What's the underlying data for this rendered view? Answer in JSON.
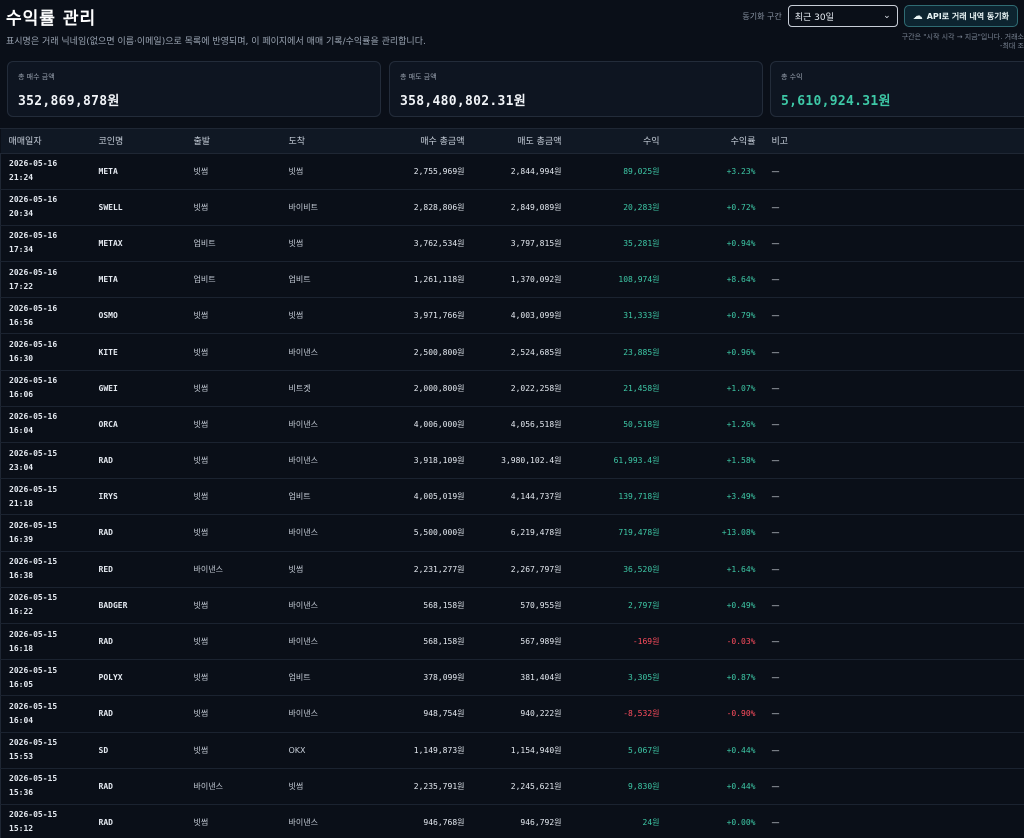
{
  "header": {
    "title": "수익률 관리",
    "description": "표시명은 거래 닉네임(없으면 이름·이메일)으로 목록에 반영되며, 이 페이지에서 매매 기록/수익률을 관리합니다."
  },
  "controls": {
    "sync_label": "동기화 구간",
    "range_value": "최근 30일",
    "sync_button": "API로 거래 내역 동기화"
  },
  "hint": {
    "line1": "구간은 \"시작 시각 → 지금\"입니다. 거래소",
    "line2": "-최대 조"
  },
  "cards": {
    "buy": {
      "label": "총 매수 금액",
      "value": "352,869,878원"
    },
    "sell": {
      "label": "총 매도 금액",
      "value": "358,480,802.31원"
    },
    "profit": {
      "label": "총 수익",
      "value": "5,610,924.31원"
    }
  },
  "table": {
    "headers": [
      "매매일자",
      "코인명",
      "출발",
      "도착",
      "매수 총금액",
      "매도 총금액",
      "수익",
      "수익률",
      "비고"
    ],
    "rows": [
      {
        "date": "2026-05-16",
        "time": "21:24",
        "coin": "META",
        "from": "빗썸",
        "to": "빗썸",
        "buy": "2,755,969원",
        "sell": "2,844,994원",
        "profit": "89,025원",
        "rate": "+3.23%",
        "note": "—",
        "sign": "pos"
      },
      {
        "date": "2026-05-16",
        "time": "20:34",
        "coin": "SWELL",
        "from": "빗썸",
        "to": "바이비트",
        "buy": "2,828,806원",
        "sell": "2,849,089원",
        "profit": "20,283원",
        "rate": "+0.72%",
        "note": "—",
        "sign": "pos"
      },
      {
        "date": "2026-05-16",
        "time": "17:34",
        "coin": "METAX",
        "from": "업비트",
        "to": "빗썸",
        "buy": "3,762,534원",
        "sell": "3,797,815원",
        "profit": "35,281원",
        "rate": "+0.94%",
        "note": "—",
        "sign": "pos"
      },
      {
        "date": "2026-05-16",
        "time": "17:22",
        "coin": "META",
        "from": "업비트",
        "to": "업비트",
        "buy": "1,261,118원",
        "sell": "1,370,092원",
        "profit": "108,974원",
        "rate": "+8.64%",
        "note": "—",
        "sign": "pos"
      },
      {
        "date": "2026-05-16",
        "time": "16:56",
        "coin": "OSMO",
        "from": "빗썸",
        "to": "빗썸",
        "buy": "3,971,766원",
        "sell": "4,003,099원",
        "profit": "31,333원",
        "rate": "+0.79%",
        "note": "—",
        "sign": "pos"
      },
      {
        "date": "2026-05-16",
        "time": "16:30",
        "coin": "KITE",
        "from": "빗썸",
        "to": "바이낸스",
        "buy": "2,500,800원",
        "sell": "2,524,685원",
        "profit": "23,885원",
        "rate": "+0.96%",
        "note": "—",
        "sign": "pos"
      },
      {
        "date": "2026-05-16",
        "time": "16:06",
        "coin": "GWEI",
        "from": "빗썸",
        "to": "비트겟",
        "buy": "2,000,800원",
        "sell": "2,022,258원",
        "profit": "21,458원",
        "rate": "+1.07%",
        "note": "—",
        "sign": "pos"
      },
      {
        "date": "2026-05-16",
        "time": "16:04",
        "coin": "ORCA",
        "from": "빗썸",
        "to": "바이낸스",
        "buy": "4,006,000원",
        "sell": "4,056,518원",
        "profit": "50,518원",
        "rate": "+1.26%",
        "note": "—",
        "sign": "pos"
      },
      {
        "date": "2026-05-15",
        "time": "23:04",
        "coin": "RAD",
        "from": "빗썸",
        "to": "바이낸스",
        "buy": "3,918,109원",
        "sell": "3,980,102.4원",
        "profit": "61,993.4원",
        "rate": "+1.58%",
        "note": "—",
        "sign": "pos"
      },
      {
        "date": "2026-05-15",
        "time": "21:18",
        "coin": "IRYS",
        "from": "빗썸",
        "to": "업비트",
        "buy": "4,005,019원",
        "sell": "4,144,737원",
        "profit": "139,718원",
        "rate": "+3.49%",
        "note": "—",
        "sign": "pos"
      },
      {
        "date": "2026-05-15",
        "time": "16:39",
        "coin": "RAD",
        "from": "빗썸",
        "to": "바이낸스",
        "buy": "5,500,000원",
        "sell": "6,219,478원",
        "profit": "719,478원",
        "rate": "+13.08%",
        "note": "—",
        "sign": "pos"
      },
      {
        "date": "2026-05-15",
        "time": "16:38",
        "coin": "RED",
        "from": "바이낸스",
        "to": "빗썸",
        "buy": "2,231,277원",
        "sell": "2,267,797원",
        "profit": "36,520원",
        "rate": "+1.64%",
        "note": "—",
        "sign": "pos"
      },
      {
        "date": "2026-05-15",
        "time": "16:22",
        "coin": "BADGER",
        "from": "빗썸",
        "to": "바이낸스",
        "buy": "568,158원",
        "sell": "570,955원",
        "profit": "2,797원",
        "rate": "+0.49%",
        "note": "—",
        "sign": "pos"
      },
      {
        "date": "2026-05-15",
        "time": "16:18",
        "coin": "RAD",
        "from": "빗썸",
        "to": "바이낸스",
        "buy": "568,158원",
        "sell": "567,989원",
        "profit": "-169원",
        "rate": "-0.03%",
        "note": "—",
        "sign": "neg"
      },
      {
        "date": "2026-05-15",
        "time": "16:05",
        "coin": "POLYX",
        "from": "빗썸",
        "to": "업비트",
        "buy": "378,099원",
        "sell": "381,404원",
        "profit": "3,305원",
        "rate": "+0.87%",
        "note": "—",
        "sign": "pos"
      },
      {
        "date": "2026-05-15",
        "time": "16:04",
        "coin": "RAD",
        "from": "빗썸",
        "to": "바이낸스",
        "buy": "948,754원",
        "sell": "940,222원",
        "profit": "-8,532원",
        "rate": "-0.90%",
        "note": "—",
        "sign": "neg"
      },
      {
        "date": "2026-05-15",
        "time": "15:53",
        "coin": "SD",
        "from": "빗썸",
        "to": "OKX",
        "buy": "1,149,873원",
        "sell": "1,154,940원",
        "profit": "5,067원",
        "rate": "+0.44%",
        "note": "—",
        "sign": "pos"
      },
      {
        "date": "2026-05-15",
        "time": "15:36",
        "coin": "RAD",
        "from": "바이낸스",
        "to": "빗썸",
        "buy": "2,235,791원",
        "sell": "2,245,621원",
        "profit": "9,830원",
        "rate": "+0.44%",
        "note": "—",
        "sign": "pos"
      },
      {
        "date": "2026-05-15",
        "time": "15:12",
        "coin": "RAD",
        "from": "빗썸",
        "to": "바이낸스",
        "buy": "946,768원",
        "sell": "946,792원",
        "profit": "24원",
        "rate": "+0.00%",
        "note": "—",
        "sign": "pos"
      }
    ]
  }
}
